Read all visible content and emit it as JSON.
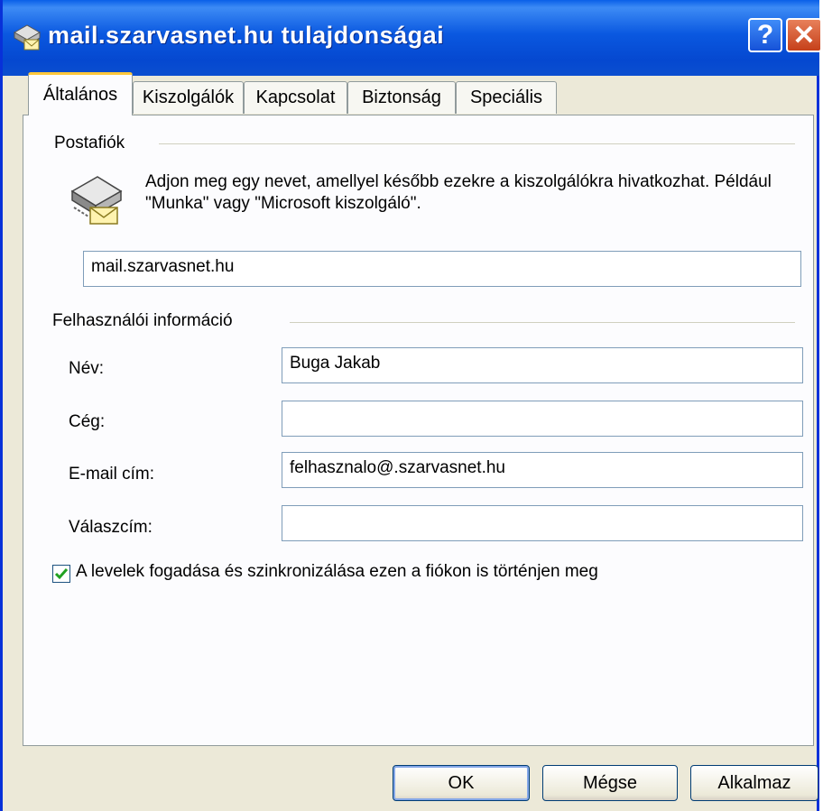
{
  "window": {
    "title": "mail.szarvasnet.hu tulajdonságai",
    "help_button": "?",
    "close_button": "✕"
  },
  "tabs": [
    {
      "label": "Általános",
      "active": true
    },
    {
      "label": "Kiszolgálók",
      "active": false
    },
    {
      "label": "Kapcsolat",
      "active": false
    },
    {
      "label": "Biztonság",
      "active": false
    },
    {
      "label": "Speciális",
      "active": false
    }
  ],
  "postafiok": {
    "group_label": "Postafiók",
    "description": "Adjon meg egy nevet, amellyel később ezekre a kiszolgálókra hivatkozhat. Például \"Munka\" vagy \"Microsoft kiszolgáló\".",
    "account_name_value": "mail.szarvasnet.hu",
    "icon": "mail-server-icon"
  },
  "user_info": {
    "group_label": "Felhasználói információ",
    "name_label": "Név:",
    "name_value": "Buga Jakab",
    "company_label": "Cég:",
    "company_value": "",
    "email_label": "E-mail cím:",
    "email_value": "felhasznalo@.szarvasnet.hu",
    "reply_label": "Válaszcím:",
    "reply_value": ""
  },
  "sync_checkbox": {
    "label": "A levelek fogadása és szinkronizálása ezen a fiókon is történjen meg",
    "checked": true
  },
  "buttons": {
    "ok": "OK",
    "cancel": "Mégse",
    "apply": "Alkalmaz"
  },
  "colors": {
    "titlebar": "#0a58e0",
    "dialog_bg": "#ece9d8",
    "tab_highlight": "#ffc83c",
    "checkmark": "#21a121"
  }
}
